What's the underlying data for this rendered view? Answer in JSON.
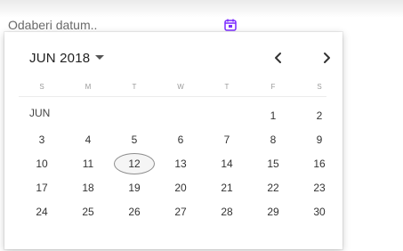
{
  "date_field": {
    "placeholder": "Odaberi datum.."
  },
  "calendar": {
    "month_year": "JUN 2018",
    "month_short": "JUN",
    "weekdays": [
      "S",
      "M",
      "T",
      "W",
      "T",
      "F",
      "S"
    ],
    "days": [
      "",
      "",
      "",
      "",
      "",
      "1",
      "2",
      "3",
      "4",
      "5",
      "6",
      "7",
      "8",
      "9",
      "10",
      "11",
      "12",
      "13",
      "14",
      "15",
      "16",
      "17",
      "18",
      "19",
      "20",
      "21",
      "22",
      "23",
      "24",
      "25",
      "26",
      "27",
      "28",
      "29",
      "30"
    ],
    "selected": "12"
  },
  "colors": {
    "accent": "#7b2cff",
    "text": "#222222",
    "muted": "#9a9a9a",
    "selected_border": "#8d8d8d"
  }
}
